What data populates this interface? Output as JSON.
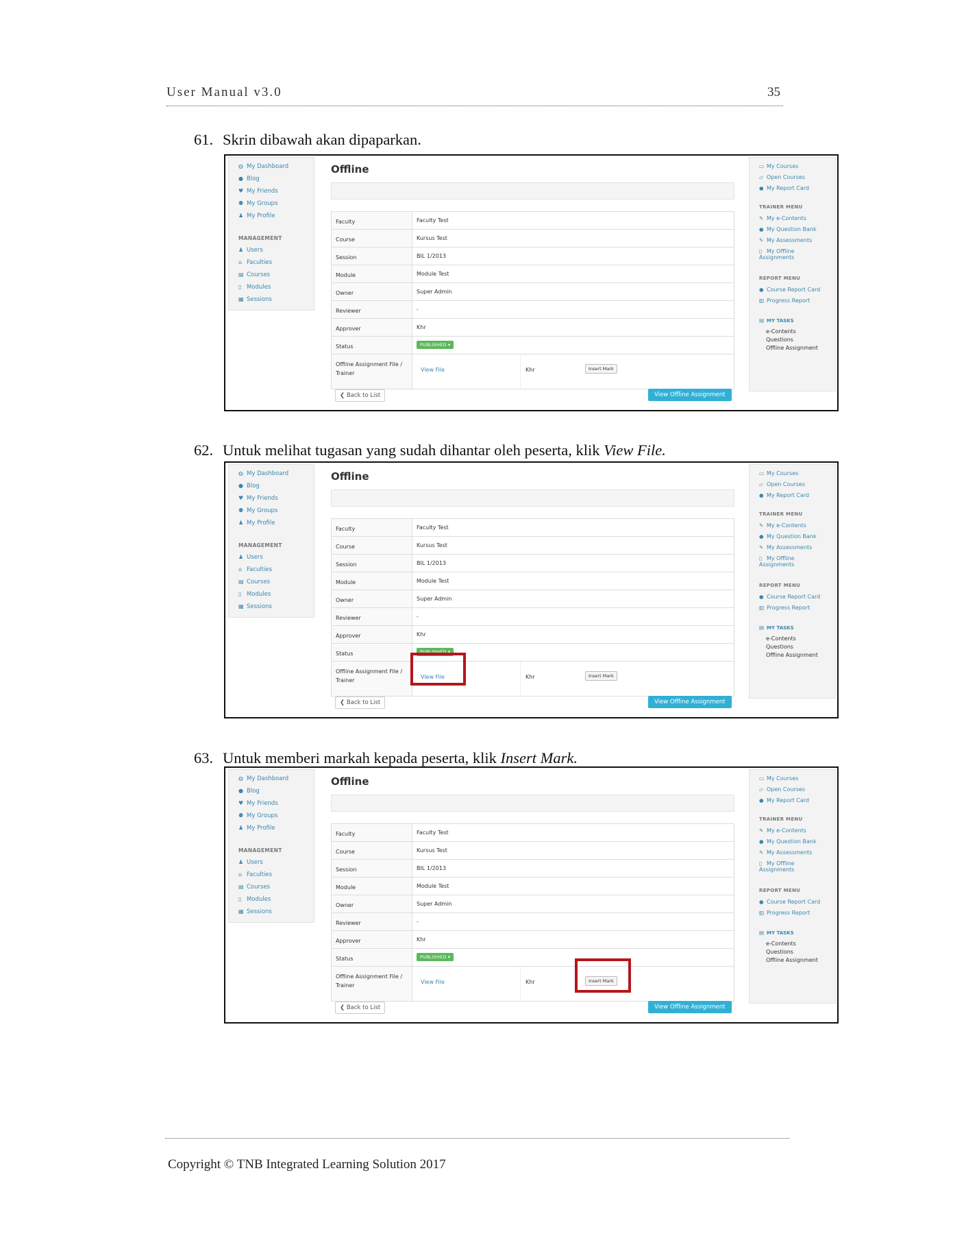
{
  "header": {
    "title": "User Manual v3.0",
    "page_number": "35"
  },
  "steps": [
    {
      "number": "61.",
      "text": "Skrin dibawah akan dipaparkan."
    },
    {
      "number": "62.",
      "text_prefix": "Untuk melihat tugasan yang sudah dihantar oleh peserta, klik ",
      "emphasis": "View File."
    },
    {
      "number": "63.",
      "text_prefix": "Untuk memberi markah kepada peserta, klik ",
      "emphasis": "Insert Mark."
    }
  ],
  "app": {
    "title": "Offline",
    "left_nav": [
      "My Dashboard",
      "Blog",
      "My Friends",
      "My Groups",
      "My Profile"
    ],
    "management_title": "MANAGEMENT",
    "management_items": [
      "Users",
      "Faculties",
      "Courses",
      "Modules",
      "Sessions"
    ],
    "details": [
      {
        "label": "Faculty",
        "value": "Faculty Test"
      },
      {
        "label": "Course",
        "value": "Kursus Test"
      },
      {
        "label": "Session",
        "value": "BIL 1/2013"
      },
      {
        "label": "Module",
        "value": "Module Test"
      },
      {
        "label": "Owner",
        "value": "Super Admin"
      },
      {
        "label": "Reviewer",
        "value": "-"
      },
      {
        "label": "Approver",
        "value": "Khr"
      }
    ],
    "status_label": "Status",
    "status_value": "PUBLISHED",
    "file_label_1": "Offline Assignment File /",
    "file_label_2": "Trainer",
    "view_file": "View File",
    "trainer_name": "Khr",
    "insert_mark": "Insert Mark",
    "back_to_list": "Back to List",
    "view_offline_assignment": "View Offline Assignment",
    "right_top": [
      "My Courses",
      "Open Courses",
      "My Report Card"
    ],
    "trainer_menu_title": "TRAINER MENU",
    "trainer_items": [
      "My e-Contents",
      "My Question Bank",
      "My Assessments"
    ],
    "trainer_offline_1": "My Offline",
    "trainer_offline_2": "Assignments",
    "report_menu_title": "REPORT MENU",
    "report_items": [
      "Course Report Card",
      "Progress Report"
    ],
    "my_tasks_title": "MY TASKS",
    "my_tasks": [
      "e-Contents",
      "Questions",
      "Offline Assignment"
    ]
  },
  "colors": {
    "link": "#3a87ad",
    "published": "#5cb85c",
    "primary_button": "#31b0d5",
    "highlight": "#b5161b"
  },
  "icons": {
    "dashboard": "dashboard-icon",
    "blog": "globe-icon",
    "friends": "heart-icon",
    "groups": "users-icon",
    "profile": "user-icon",
    "back": "chevron-left-icon"
  },
  "footer": {
    "text": "Copyright © TNB Integrated Learning Solution 2017"
  }
}
